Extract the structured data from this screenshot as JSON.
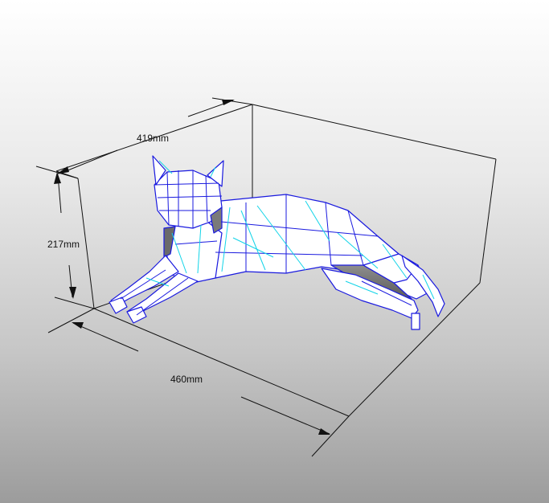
{
  "dimensions": {
    "depth_label": "419mm",
    "height_label": "217mm",
    "width_label": "460mm"
  },
  "colors": {
    "edge": "#1a1adf",
    "crease": "#11d4e8",
    "face_light": "#ffffff",
    "face_shadow": "#9a9a9a",
    "face_dark": "#5b5b5b"
  },
  "model": {
    "subject": "low-poly cat papercraft",
    "icon": "cat-model-icon"
  }
}
